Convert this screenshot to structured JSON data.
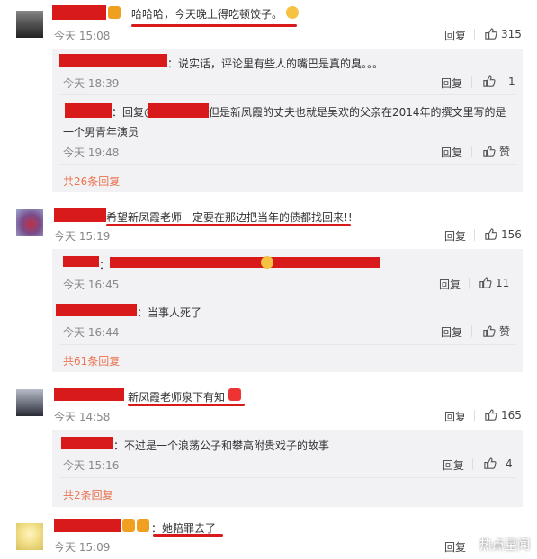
{
  "comments": [
    {
      "text": "哈哈哈，今天晚上得吃顿饺子。",
      "time": "今天 15:08",
      "reply_label": "回复",
      "likes": "315",
      "replies": [
        {
          "text": "：说实话，评论里有些人的嘴巴是真的臭。。。",
          "time": "今天 18:39",
          "reply_label": "回复",
          "likes": "1"
        },
        {
          "prefix": "：回复@",
          "text": "但是新凤霞的丈夫也就是吴欢的父亲在2014年的撰文里写的是",
          "text2": "一个男青年演员",
          "time": "今天 19:48",
          "reply_label": "回复",
          "likes": "赞"
        }
      ],
      "more": "共26条回复"
    },
    {
      "text": "希望新凤霞老师一定要在那边把当年的债都找回来!!",
      "time": "今天 15:19",
      "reply_label": "回复",
      "likes": "156",
      "replies": [
        {
          "text": "：",
          "time": "今天 16:45",
          "reply_label": "回复",
          "likes": "11"
        },
        {
          "text": "：当事人死了",
          "time": "今天 16:44",
          "reply_label": "回复",
          "likes": "赞"
        }
      ],
      "more": "共61条回复"
    },
    {
      "text": "新凤霞老师泉下有知",
      "time": "今天 14:58",
      "reply_label": "回复",
      "likes": "165",
      "replies": [
        {
          "text": "：不过是一个浪荡公子和攀高附贵戏子的故事",
          "time": "今天 15:16",
          "reply_label": "回复",
          "likes": "4"
        }
      ],
      "more": "共2条回复"
    },
    {
      "text": "：她陪罪去了",
      "time": "今天 15:09",
      "reply_label": "回复",
      "likes": ""
    }
  ],
  "watermark": "热点星闻",
  "colors": {
    "redaction": "#d81a1a",
    "more_link": "#eb7350",
    "subbox_bg": "#f2f2f5"
  }
}
